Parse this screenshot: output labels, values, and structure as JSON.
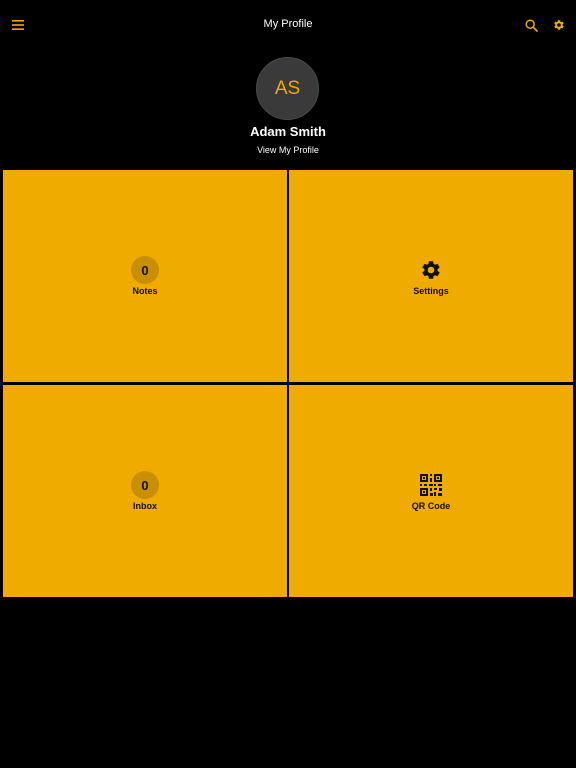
{
  "header": {
    "title": "My Profile",
    "menu_icon": "hamburger-menu-icon",
    "search_icon": "search-icon",
    "settings_icon": "gear-icon"
  },
  "profile": {
    "initials": "AS",
    "name": "Adam Smith",
    "view_profile_label": "View My Profile"
  },
  "tiles": [
    {
      "label": "Notes",
      "count": "0",
      "icon": "count-badge"
    },
    {
      "label": "Settings",
      "icon": "gear-icon"
    },
    {
      "label": "Inbox",
      "count": "0",
      "icon": "count-badge"
    },
    {
      "label": "QR Code",
      "icon": "qr-code-icon"
    }
  ],
  "colors": {
    "accent": "#F0AB00",
    "background": "#000000",
    "badge": "#C98F00",
    "text_dark": "#111111",
    "text_light": "#FFFFFF"
  }
}
